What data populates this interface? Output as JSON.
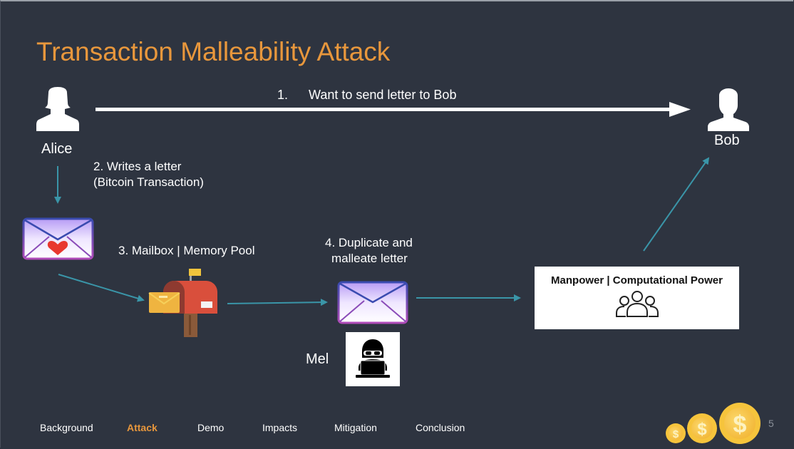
{
  "slide": {
    "title": "Transaction Malleability Attack",
    "page_number": "5",
    "colors": {
      "background": "#2e3440",
      "accent": "#e8973c",
      "arrow": "#3a95a8",
      "text": "#ffffff"
    }
  },
  "actors": {
    "alice": {
      "label": "Alice",
      "icon": "person-female-icon"
    },
    "bob": {
      "label": "Bob",
      "icon": "person-male-icon"
    },
    "mel": {
      "label": "Mel",
      "icon": "hacker-laptop-icon"
    }
  },
  "steps": {
    "step1_num": "1.",
    "step1_text": "Want to send letter to Bob",
    "step2_line1": "2. Writes a letter",
    "step2_line2": "(Bitcoin Transaction)",
    "step3": "3. Mailbox | Memory Pool",
    "step4_line1": "4. Duplicate and",
    "step4_line2": "malleate letter"
  },
  "power_box": {
    "title": "Manpower | Computational Power",
    "icon": "group-users-icon"
  },
  "nav": {
    "items": [
      {
        "label": "Background",
        "active": false
      },
      {
        "label": "Attack",
        "active": true
      },
      {
        "label": "Demo",
        "active": false
      },
      {
        "label": "Impacts",
        "active": false
      },
      {
        "label": "Mitigation",
        "active": false
      },
      {
        "label": "Conclusion",
        "active": false
      }
    ]
  }
}
